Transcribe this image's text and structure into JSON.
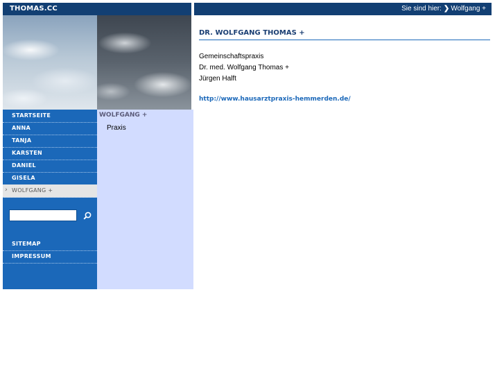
{
  "header": {
    "brand": "THOMAS.CC",
    "breadcrumb_prefix": "Sie sind hier:",
    "breadcrumb_current": "Wolfgang +"
  },
  "nav": {
    "items": [
      {
        "label": "STARTSEITE"
      },
      {
        "label": "ANNA"
      },
      {
        "label": "TANJA"
      },
      {
        "label": "KARSTEN"
      },
      {
        "label": "DANIEL"
      },
      {
        "label": "GISELA"
      },
      {
        "label": "WOLFGANG +",
        "active": true
      }
    ],
    "footer_items": [
      {
        "label": "SITEMAP"
      },
      {
        "label": "IMPRESSUM"
      }
    ]
  },
  "search": {
    "value": "",
    "placeholder": ""
  },
  "subnav": {
    "title": "WOLFGANG +",
    "links": [
      {
        "label": "Praxis"
      }
    ]
  },
  "content": {
    "title": "DR. WOLFGANG THOMAS +",
    "lines": [
      "Gemeinschaftspraxis",
      "Dr. med. Wolfgang Thomas +",
      "Jürgen Halft"
    ],
    "link": "http://www.hausarztpraxis-hemmerden.de/"
  },
  "colors": {
    "header_bar": "#123f73",
    "nav_bg": "#1b68b9",
    "subnav_bg": "#d2dcff",
    "active_item_bg": "#e5e5e5",
    "link": "#1b68b9"
  }
}
